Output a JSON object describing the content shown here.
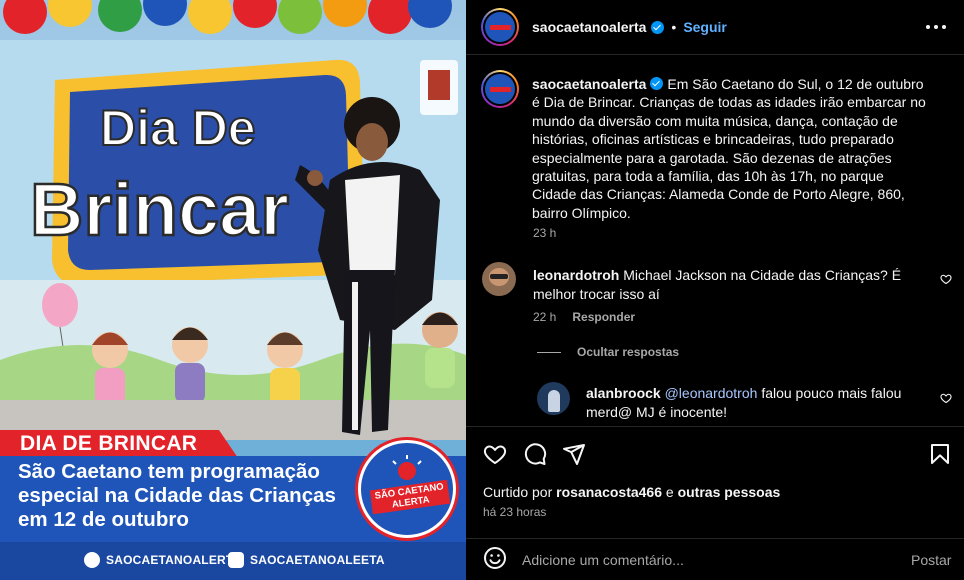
{
  "image": {
    "sign_line1": "Dia De",
    "sign_line2": "Brincar",
    "banner_title": "DIA DE BRINCAR",
    "banner_lines": [
      "São Caetano tem programação",
      "especial na Cidade das Crianças",
      "em 12 de outubro"
    ],
    "badge_text": "SÃO CAETANO ALERTA",
    "facebook_handle": "SAOCAETANOALERTA",
    "instagram_handle": "SAOCAETANOALEETA"
  },
  "header": {
    "username": "saocaetanoalerta",
    "separator": "•",
    "follow_label": "Seguir"
  },
  "caption": {
    "username": "saocaetanoalerta",
    "text": "Em São Caetano do Sul, o 12 de outubro é Dia de Brincar. Crianças de todas as idades irão embarcar no mundo da diversão com muita música, dança, contação de histórias, oficinas artísticas e brincadeiras, tudo preparado especialmente para a garotada. São dezenas de atrações gratuitas, para toda a família, das 10h às 17h, no parque Cidade das Crianças: Alameda Conde de Porto Alegre, 860, bairro Olímpico.",
    "time": "23 h"
  },
  "comments": [
    {
      "username": "leonardotroh",
      "text": "Michael Jackson na Cidade das Crianças? É melhor trocar isso aí",
      "time": "22 h",
      "reply_label": "Responder"
    }
  ],
  "hide_replies_label": "Ocultar respostas",
  "reply": {
    "username": "alanbroock",
    "mention": "@leonardotroh",
    "text": "falou pouco mais falou merd@ MJ é inocente!"
  },
  "likes": {
    "prefix": "Curtido por",
    "user": "rosanacosta466",
    "conj": "e",
    "others": "outras pessoas"
  },
  "posted_ago": "há 23 horas",
  "comment_box": {
    "placeholder": "Adicione um comentário...",
    "post_label": "Postar"
  },
  "colors": {
    "accent_blue": "#0095f6",
    "banner_red": "#e3232a",
    "banner_blue": "#1f55b8",
    "background": "#000000"
  }
}
